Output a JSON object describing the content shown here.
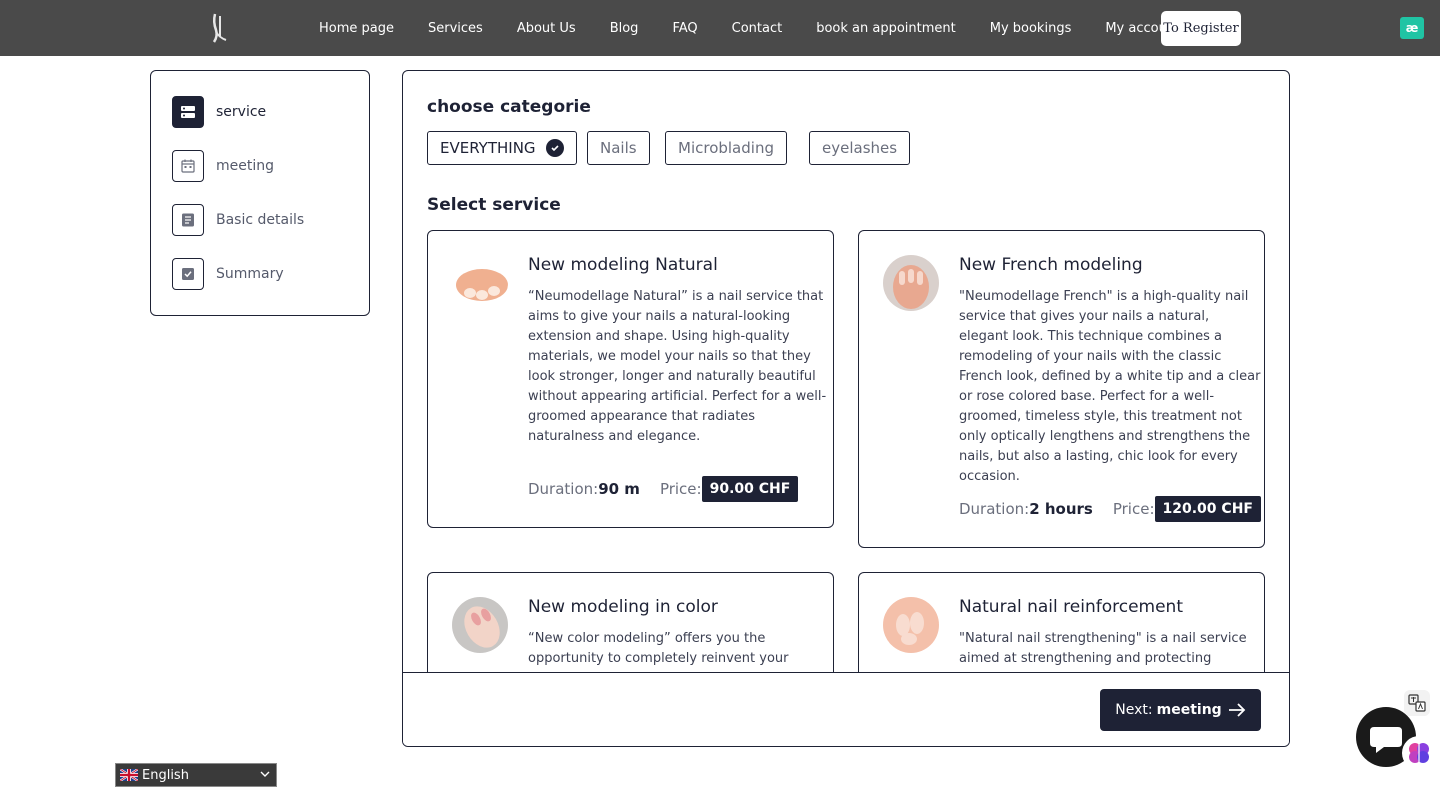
{
  "nav": {
    "items": [
      "Home page",
      "Services",
      "About Us",
      "Blog",
      "FAQ",
      "Contact",
      "book an appointment",
      "My bookings",
      "My account"
    ],
    "register_label": "To Register",
    "ext_icon_text": "æ"
  },
  "steps": [
    {
      "label": "service",
      "icon": "server-icon",
      "active": true
    },
    {
      "label": "meeting",
      "icon": "calendar-icon",
      "active": false
    },
    {
      "label": "Basic details",
      "icon": "document-icon",
      "active": false
    },
    {
      "label": "Summary",
      "icon": "checkbox-icon",
      "active": false
    }
  ],
  "main": {
    "category_title": "choose categorie",
    "categories": [
      {
        "label": "EVERYTHING",
        "selected": true
      },
      {
        "label": "Nails",
        "selected": false
      },
      {
        "label": "Microblading",
        "selected": false
      },
      {
        "label": "eyelashes",
        "selected": false
      }
    ],
    "service_title": "Select service",
    "duration_label": "Duration:",
    "price_label": "Price:",
    "services": [
      {
        "title": "New modeling Natural",
        "description": "“Neumodellage Natural” is a nail service that aims to give your nails a natural-looking extension and shape. Using high-quality materials, we model your nails so that they look stronger, longer and naturally beautiful without appearing artificial. Perfect for a well-groomed appearance that radiates naturalness and elegance.",
        "duration": "90 m",
        "price": "90.00 CHF"
      },
      {
        "title": "New French modeling",
        "description": "\"Neumodellage French\" is a high-quality nail service that gives your nails a natural, elegant look. This technique combines a remodeling of your nails with the classic French look, defined by a white tip and a clear or rose colored base. Perfect for a well-groomed, timeless style, this treatment not only optically lengthens and strengthens the nails, but also a lasting, chic look for every occasion.",
        "duration": "2 hours",
        "price": "120.00 CHF"
      },
      {
        "title": "New modeling in color",
        "description": "“New color modeling” offers you the opportunity to completely reinvent your",
        "duration": "",
        "price": ""
      },
      {
        "title": "Natural nail reinforcement",
        "description": "\"Natural nail strengthening\" is a nail service aimed at strengthening and protecting",
        "duration": "",
        "price": ""
      }
    ],
    "next_prefix": "Next:",
    "next_target": "meeting"
  },
  "language": {
    "selected": "English"
  },
  "colors": {
    "primary": "#1e2235",
    "navbar": "#4a4a4a",
    "accent_ext": "#20c4a4"
  }
}
